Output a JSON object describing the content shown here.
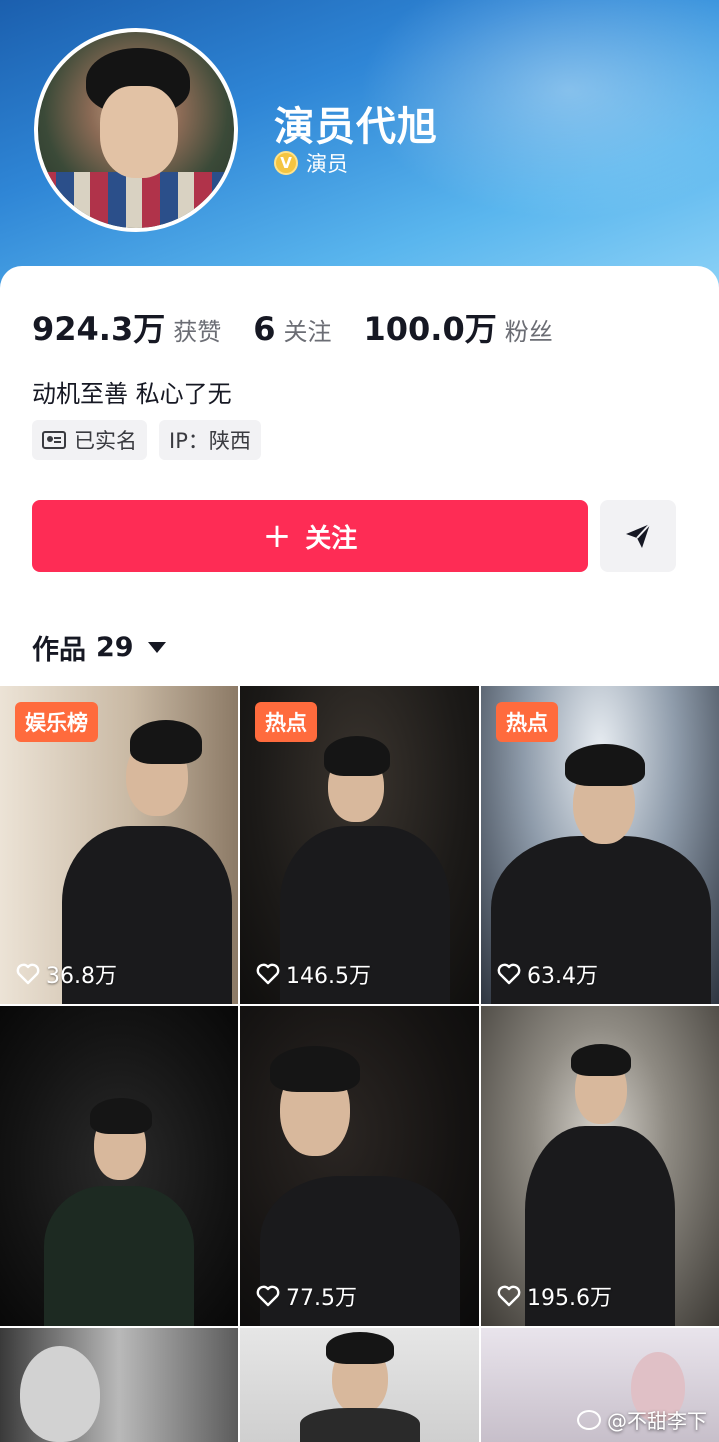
{
  "profile": {
    "name": "演员代旭",
    "verify_label": "演员",
    "verify_icon": "verified-v-badge"
  },
  "stats": [
    {
      "value": "924.3万",
      "label": "获赞"
    },
    {
      "value": "6",
      "label": "关注"
    },
    {
      "value": "100.0万",
      "label": "粉丝"
    }
  ],
  "bio": "动机至善 私心了无",
  "tags": [
    {
      "icon": "id-card-icon",
      "label": "已实名"
    },
    {
      "label": "IP：陕西"
    }
  ],
  "actions": {
    "follow_label": "关注",
    "follow_icon": "plus-icon",
    "share_icon": "send-icon"
  },
  "works_tab": {
    "label": "作品",
    "count": "29"
  },
  "videos": [
    {
      "badge": "娱乐榜",
      "likes": "36.8万"
    },
    {
      "badge": "热点",
      "likes": "146.5万"
    },
    {
      "badge": "热点",
      "likes": "63.4万"
    },
    {
      "badge": "",
      "likes": ""
    },
    {
      "badge": "",
      "likes": "77.5万"
    },
    {
      "badge": "",
      "likes": "195.6万"
    },
    {
      "badge": "",
      "likes": ""
    },
    {
      "badge": "",
      "likes": ""
    },
    {
      "badge": "",
      "likes": ""
    }
  ],
  "watermark": "@不甜李下",
  "colors": {
    "accent": "#fe2c55",
    "badge": "#ff6b3d",
    "header": "#2f86d6"
  }
}
